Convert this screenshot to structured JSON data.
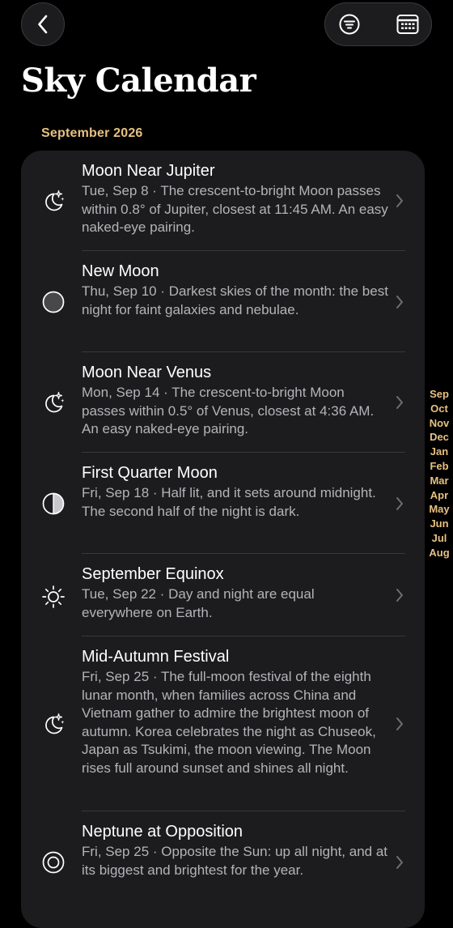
{
  "header": {
    "back_icon": "chevron-left-icon",
    "filter_icon": "filter-icon",
    "calendar_icon": "calendar-grid-icon"
  },
  "page_title": "Sky Calendar",
  "section": {
    "month": "September 2026"
  },
  "events": [
    {
      "icon": "moon-stars-icon",
      "title": "Moon Near Jupiter",
      "description": "Tue, Sep 8 · The crescent-to-bright Moon passes within 0.8° of Jupiter, closest at 11:45 AM. An easy naked-eye pairing."
    },
    {
      "icon": "new-moon-icon",
      "title": "New Moon",
      "description": "Thu, Sep 10 · Darkest skies of the month: the best night for faint galaxies and nebulae."
    },
    {
      "icon": "moon-stars-icon",
      "title": "Moon Near Venus",
      "description": "Mon, Sep 14 · The crescent-to-bright Moon passes within 0.5° of Venus, closest at 4:36 AM. An easy naked-eye pairing."
    },
    {
      "icon": "first-quarter-moon-icon",
      "title": "First Quarter Moon",
      "description": "Fri, Sep 18 · Half lit, and it sets around midnight. The second half of the night is dark."
    },
    {
      "icon": "sun-icon",
      "title": "September Equinox",
      "description": "Tue, Sep 22 · Day and night are equal everywhere on Earth."
    },
    {
      "icon": "moon-stars-icon",
      "title": "Mid-Autumn Festival",
      "description": "Fri, Sep 25 · The full-moon festival of the eighth lunar month, when families across China and Vietnam gather to admire the brightest moon of autumn. Korea celebrates the night as Chuseok, Japan as Tsukimi, the moon viewing. The Moon rises full around sunset and shines all night."
    },
    {
      "icon": "planet-target-icon",
      "title": "Neptune at Opposition",
      "description": "Fri, Sep 25 · Opposite the Sun: up all night, and at its biggest and brightest for the year."
    }
  ],
  "month_index": [
    "Sep",
    "Oct",
    "Nov",
    "Dec",
    "Jan",
    "Feb",
    "Mar",
    "Apr",
    "May",
    "Jun",
    "Jul",
    "Aug"
  ],
  "colors": {
    "background": "#000000",
    "card": "#1c1c1e",
    "accent": "#e8c080",
    "secondary_text": "#b4b4b8"
  }
}
